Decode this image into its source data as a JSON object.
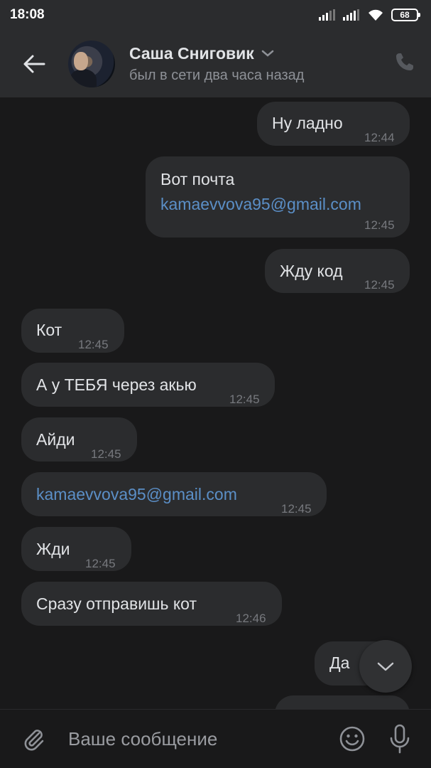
{
  "status_bar": {
    "time": "18:08",
    "battery": "68"
  },
  "header": {
    "contact_name": "Саша Сниговик",
    "last_seen": "был в сети два часа назад"
  },
  "messages": [
    {
      "direction": "out",
      "text": "Ну ладно",
      "time": "12:44"
    },
    {
      "direction": "out",
      "text": "Вот почта",
      "link": "kamaevvova95@gmail.com",
      "time": "12:45"
    },
    {
      "direction": "out",
      "text": "Жду код",
      "time": "12:45"
    },
    {
      "direction": "in",
      "text": "Кот",
      "time": "12:45"
    },
    {
      "direction": "in",
      "text": "А у ТЕБЯ через акью",
      "time": "12:45"
    },
    {
      "direction": "in",
      "text": "Айди",
      "time": "12:45"
    },
    {
      "direction": "in",
      "link": "kamaevvova95@gmail.com",
      "time": "12:45"
    },
    {
      "direction": "in",
      "text": "Жди",
      "time": "12:45"
    },
    {
      "direction": "in",
      "text": "Сразу отправишь кот",
      "time": "12:46"
    },
    {
      "direction": "out",
      "text": "Да"
    }
  ],
  "composer": {
    "placeholder": "Ваше сообщение"
  },
  "colors": {
    "background": "#19191a",
    "bubble": "#2b2c2e",
    "link": "#5b8fc7",
    "meta": "#77797e"
  }
}
